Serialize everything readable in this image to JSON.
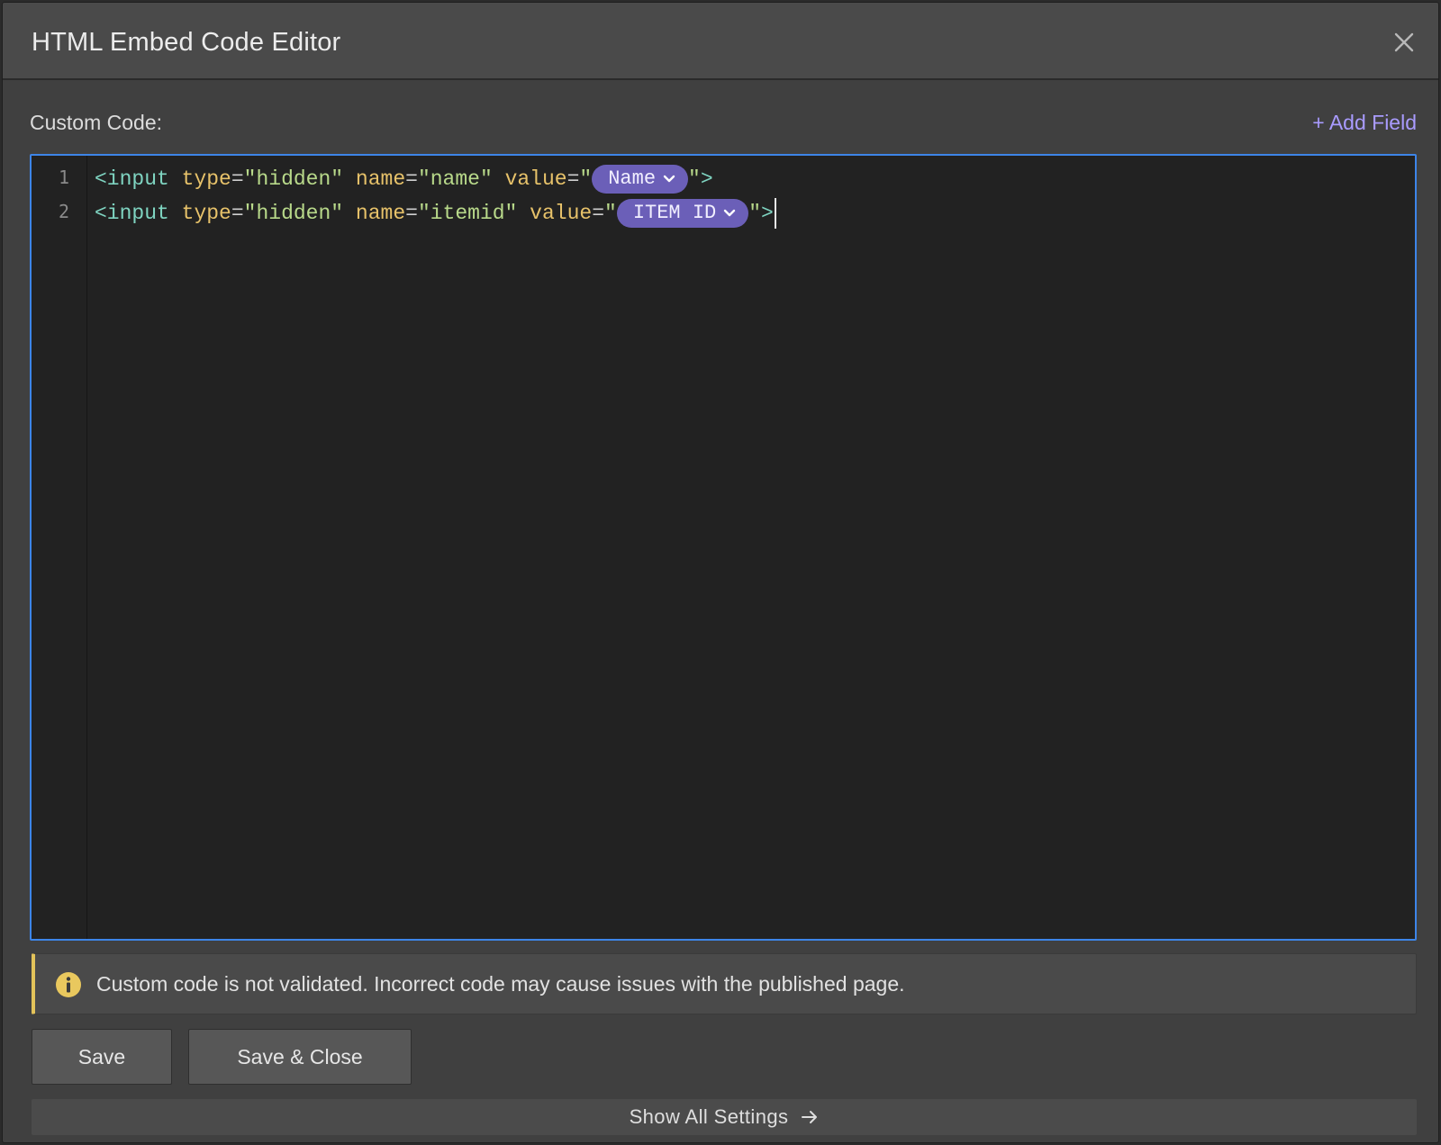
{
  "dialog": {
    "title": "HTML Embed Code Editor"
  },
  "editor_section": {
    "label": "Custom Code:",
    "add_field_label": "+ Add Field"
  },
  "code": {
    "lines": [
      {
        "number": "1",
        "tag_open": "<input",
        "type_attr": "type",
        "eq1": "=",
        "type_value": "\"hidden\"",
        "name_attr": "name",
        "eq2": "=",
        "name_value": "\"name\"",
        "value_attr": "value",
        "eq3": "=",
        "quote_open": "\"",
        "field_pill": "Name",
        "quote_close": "\"",
        "tag_close": ">"
      },
      {
        "number": "2",
        "tag_open": "<input",
        "type_attr": "type",
        "eq1": "=",
        "type_value": "\"hidden\"",
        "name_attr": "name",
        "eq2": "=",
        "name_value": "\"itemid\"",
        "value_attr": "value",
        "eq3": "=",
        "quote_open": "\"",
        "field_pill": "ITEM ID",
        "quote_close": "\"",
        "tag_close": ">"
      }
    ]
  },
  "notice": {
    "icon": "info-icon",
    "text": "Custom code is not validated. Incorrect code may cause issues with the published page."
  },
  "buttons": {
    "save": "Save",
    "save_close": "Save & Close"
  },
  "footer": {
    "show_all_settings": "Show All Settings",
    "icon": "arrow-right-icon"
  },
  "colors": {
    "accent_link": "#a99bff",
    "pill_bg": "#6b5fb8",
    "editor_focus_border": "#3d85e8",
    "notice_accent": "#e3c35a"
  }
}
